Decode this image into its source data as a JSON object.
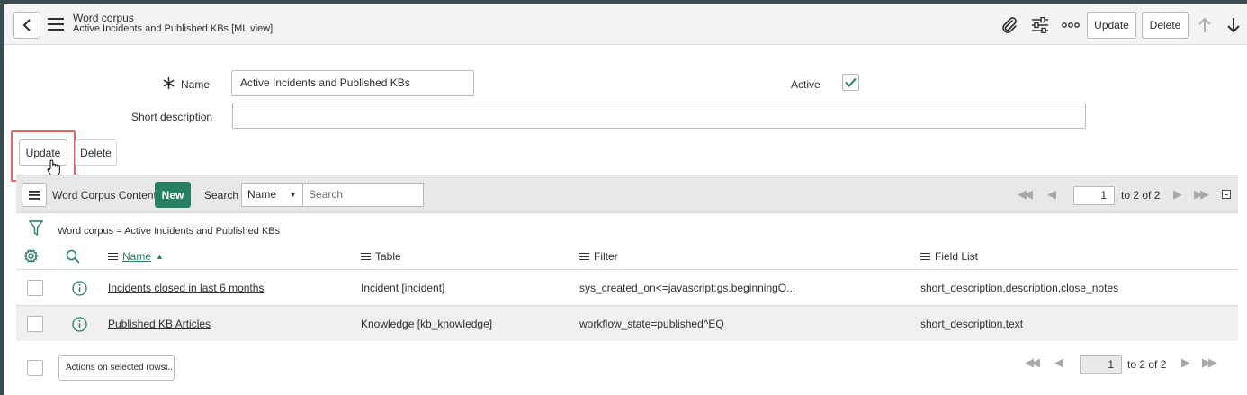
{
  "header": {
    "table_label": "Word corpus",
    "record_title": "Active Incidents and Published KBs [ML view]",
    "update_label": "Update",
    "delete_label": "Delete"
  },
  "form": {
    "name_label": "Name",
    "name_value": "Active Incidents and Published KBs",
    "active_label": "Active",
    "active_checked": true,
    "short_description_label": "Short description",
    "short_description_value": "",
    "update_label": "Update",
    "delete_label": "Delete"
  },
  "list": {
    "title": "Word Corpus Content",
    "new_label": "New",
    "search_label": "Search",
    "search_field": "Name",
    "search_placeholder": "Search",
    "page_value": "1",
    "page_text": "to 2 of 2",
    "breadcrumb": "Word corpus = Active Incidents and Published KBs",
    "columns": [
      "Name",
      "Table",
      "Filter",
      "Field List"
    ],
    "sort_indicator": "▲",
    "rows": [
      {
        "name": "Incidents closed in last 6 months",
        "table": "Incident [incident]",
        "filter": "sys_created_on<=javascript:gs.beginningO...",
        "field_list": "short_description,description,close_notes"
      },
      {
        "name": "Published KB Articles",
        "table": "Knowledge [kb_knowledge]",
        "filter": "workflow_state=published^EQ",
        "field_list": "short_description,text"
      }
    ],
    "actions_placeholder": "Actions on selected rows...",
    "bottom_page_value": "1",
    "bottom_page_text": "to 2 of 2"
  },
  "colors": {
    "accent_green": "#278062",
    "highlight_red": "#e2645a",
    "dark_strip": "#3b4b52"
  }
}
